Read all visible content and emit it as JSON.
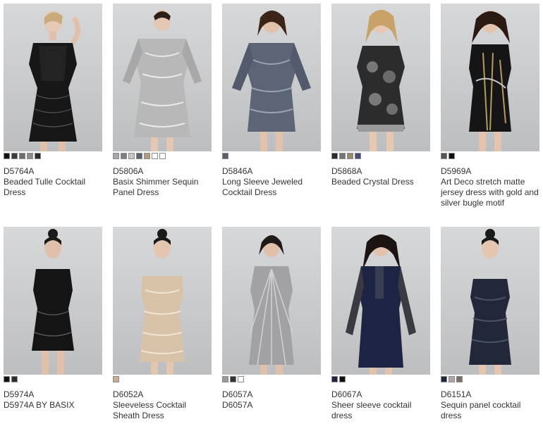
{
  "products": [
    {
      "sku": "D5764A",
      "name": "Beaded Tulle Cocktail Dress",
      "swatches": [
        "#111111",
        "#3a3a3a",
        "#6d6d6d",
        "#8d8d8d",
        "#2a2a2a"
      ]
    },
    {
      "sku": "D5806A",
      "name": "Basix Shimmer Sequin Panel Dress",
      "swatches": [
        "#a8a8a8",
        "#7b7f86",
        "#c7c7c7",
        "#5b6274",
        "#b59b7e",
        "#ffffff",
        "#ffffff"
      ]
    },
    {
      "sku": "D5846A",
      "name": "Long Sleeve Jeweled Cocktail Dress",
      "swatches": [
        "#59606c"
      ]
    },
    {
      "sku": "D5868A",
      "name": "Beaded Crystal Dress",
      "swatches": [
        "#2b2b2b",
        "#757575",
        "#958a6a",
        "#504a7a"
      ]
    },
    {
      "sku": "D5969A",
      "name": "Art Deco stretch matte jersey dress with gold and silver bugle motif",
      "swatches": [
        "#555555",
        "#111111"
      ]
    },
    {
      "sku": "D5974A",
      "name": "D5974A BY BASIX",
      "swatches": [
        "#111111",
        "#2c2c2c"
      ]
    },
    {
      "sku": "D6052A",
      "name": "Sleeveless Cocktail Sheath Dress",
      "swatches": [
        "#c9ad92"
      ]
    },
    {
      "sku": "D6057A",
      "name": "D6057A",
      "swatches": [
        "#9a9a9a",
        "#333333",
        "#ffffff"
      ]
    },
    {
      "sku": "D6067A",
      "name": "Sheer sleeve cocktail dress",
      "swatches": [
        "#1d2340",
        "#111111"
      ]
    },
    {
      "sku": "D6151A",
      "name": "Sequin panel cocktail dress",
      "swatches": [
        "#202738",
        "#a8a8a8",
        "#7a6f64"
      ]
    }
  ]
}
